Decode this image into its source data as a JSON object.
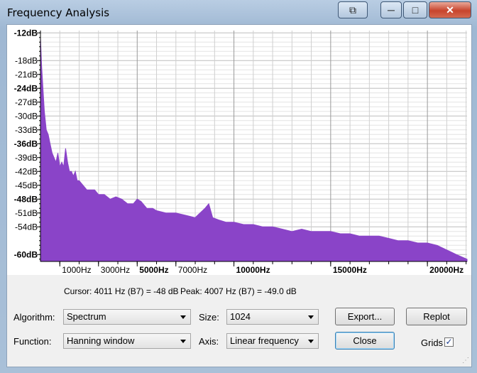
{
  "window": {
    "title": "Frequency Analysis",
    "controls": {
      "extra": "⧉",
      "minimize": "─",
      "maximize": "□",
      "close": "✕"
    }
  },
  "chart_data": {
    "type": "area",
    "xlabel": "",
    "ylabel": "",
    "xlim": [
      0,
      22050
    ],
    "ylim": [
      -61.5,
      -11.5
    ],
    "x_ticks": [
      "1000Hz",
      "3000Hz",
      "5000Hz",
      "7000Hz",
      "10000Hz",
      "15000Hz",
      "20000Hz"
    ],
    "x_tick_values": [
      1000,
      3000,
      5000,
      7000,
      10000,
      15000,
      20000
    ],
    "x_tick_bold": [
      false,
      false,
      true,
      false,
      true,
      true,
      true
    ],
    "y_ticks": [
      "-12dB",
      "-18dB",
      "-21dB",
      "-24dB",
      "-27dB",
      "-30dB",
      "-33dB",
      "-36dB",
      "-39dB",
      "-42dB",
      "-45dB",
      "-48dB",
      "-51dB",
      "-54dB",
      "-60dB"
    ],
    "y_tick_values": [
      -12,
      -18,
      -21,
      -24,
      -27,
      -30,
      -33,
      -36,
      -39,
      -42,
      -45,
      -48,
      -51,
      -54,
      -60
    ],
    "y_tick_bold": [
      true,
      false,
      false,
      true,
      false,
      false,
      false,
      true,
      false,
      false,
      false,
      true,
      false,
      false,
      true
    ],
    "grid": true,
    "color": "#8a44c8",
    "series": [
      {
        "x": [
          0,
          60,
          130,
          200,
          300,
          400,
          500,
          600,
          700,
          800,
          900,
          1000,
          1100,
          1200,
          1300,
          1400,
          1500,
          1600,
          1700,
          1800,
          1900,
          2000,
          2200,
          2400,
          2600,
          2800,
          3000,
          3300,
          3600,
          3900,
          4200,
          4500,
          4800,
          5000,
          5200,
          5500,
          5800,
          6000,
          6500,
          7000,
          7500,
          8000,
          8500,
          8700,
          8900,
          9200,
          9600,
          10000,
          10500,
          11000,
          11500,
          12000,
          12500,
          13000,
          13500,
          14000,
          14500,
          15000,
          15500,
          16000,
          16500,
          17000,
          17500,
          18000,
          18500,
          19000,
          19500,
          20000,
          20500,
          21000,
          21500,
          22050
        ],
        "values": [
          -13,
          -19,
          -24,
          -29,
          -33,
          -34,
          -36,
          -38,
          -39,
          -40,
          -38,
          -41,
          -40,
          -41,
          -37,
          -40,
          -42,
          -42,
          -43,
          -42,
          -44,
          -44,
          -45,
          -46,
          -46,
          -46,
          -47,
          -47,
          -48,
          -47.5,
          -48,
          -49,
          -49,
          -48,
          -48.5,
          -50,
          -50,
          -50.5,
          -51,
          -51,
          -51.5,
          -52,
          -50,
          -49,
          -52,
          -52.5,
          -53,
          -53,
          -53.5,
          -53.5,
          -54,
          -54,
          -54.5,
          -55,
          -54.5,
          -55,
          -55,
          -55,
          -55.5,
          -55.5,
          -56,
          -56,
          -56,
          -56.5,
          -57,
          -57,
          -57.5,
          -57.5,
          -58,
          -59,
          -60,
          -61
        ]
      }
    ]
  },
  "readout": {
    "cursor": "Cursor: 4011 Hz (B7) = -48 dB",
    "peak": "Peak: 4007 Hz (B7) = -49.0 dB"
  },
  "controls": {
    "algorithm_label": "Algorithm:",
    "algorithm_value": "Spectrum",
    "function_label": "Function:",
    "function_value": "Hanning window",
    "size_label": "Size:",
    "size_value": "1024",
    "axis_label": "Axis:",
    "axis_value": "Linear frequency",
    "export_label": "Export...",
    "replot_label": "Replot",
    "close_label": "Close",
    "grids_label": "Grids",
    "grids_checked": "✓"
  }
}
